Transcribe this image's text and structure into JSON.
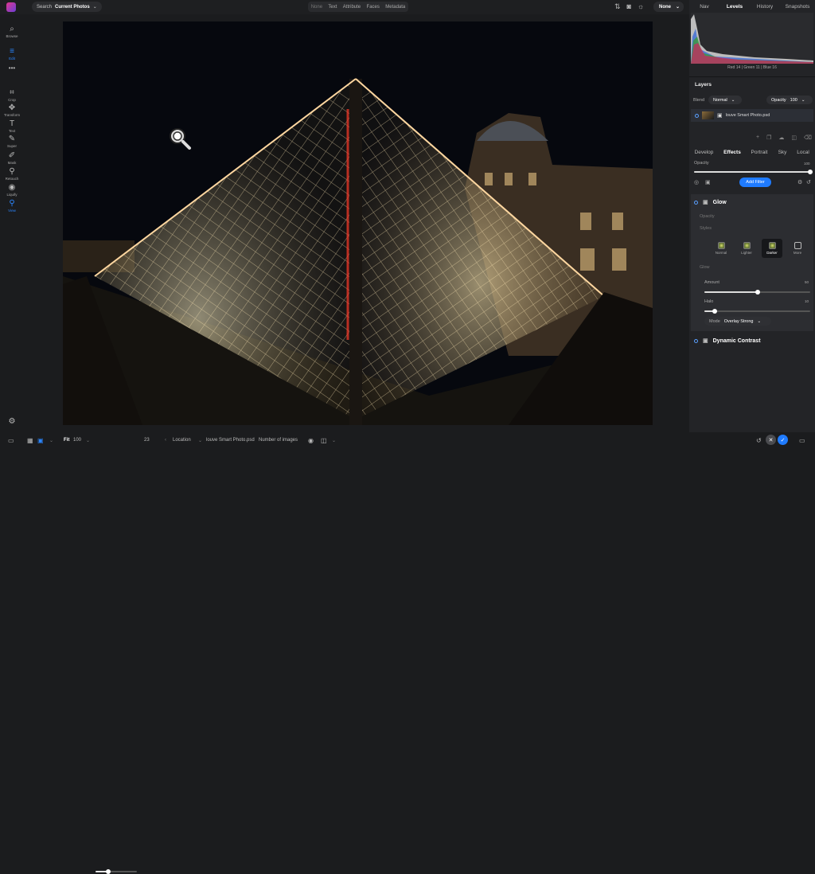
{
  "topbar": {
    "search_label": "Search",
    "search_value": "Current Photos",
    "segments": [
      "None",
      "Text",
      "Attribute",
      "Faces",
      "Metadata"
    ],
    "sort_value": "None"
  },
  "toolbar": {
    "browse": "Browse",
    "edit": "Edit",
    "crop": "Crop",
    "transform": "Transform",
    "text": "Text",
    "super": "Super",
    "mask": "Mask",
    "retouch": "Retouch",
    "liquify": "Liquify",
    "view": "View"
  },
  "bottombar": {
    "fit_label": "Fit",
    "zoom_value": "100",
    "slider_value": "23",
    "zoom_fraction": 0.3,
    "location_label": "Location",
    "file_name": "louve Smart Photo.psd",
    "images_label": "Number of images"
  },
  "right_panel": {
    "tabs": [
      "Nav",
      "Levels",
      "History",
      "Snapshots"
    ],
    "active_tab": "Levels",
    "rgb_readout": "Red 14 | Green 11 | Blue 16",
    "layers": {
      "title": "Layers",
      "blend_label": "Blend",
      "blend_value": "Normal",
      "opacity_label": "Opacity",
      "opacity_value": "100",
      "layer_name": "louve Smart Photo.psd"
    },
    "edit_tabs": [
      "Develop",
      "Effects",
      "Portrait",
      "Sky",
      "Local"
    ],
    "active_edit_tab": "Effects",
    "effects_opacity_label": "Opacity",
    "effects_opacity_value": "100",
    "add_filter_label": "Add Filter",
    "glow": {
      "title": "Glow",
      "opacity_label": "Opacity",
      "styles_label": "Styles",
      "styles": [
        "Normal",
        "Lighter",
        "Darker",
        "More"
      ],
      "selected_style": "Darker",
      "glow_section": "Glow",
      "amount_label": "Amount",
      "amount_value": "50",
      "amount_fraction": 0.5,
      "halo_label": "Halo",
      "halo_value": "10",
      "halo_fraction": 0.1,
      "mode_label": "Mode",
      "mode_value": "Overlay Strong"
    },
    "dynamic_contrast_title": "Dynamic Contrast"
  },
  "colors": {
    "accent": "#1f7bff",
    "panel": "#232427",
    "background": "#1b1c1e"
  }
}
